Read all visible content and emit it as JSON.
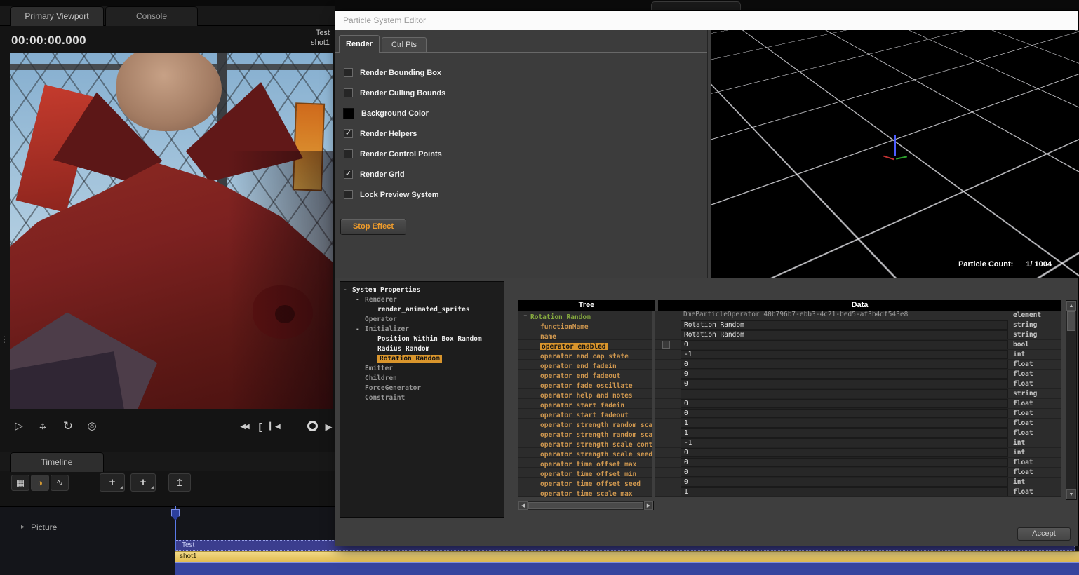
{
  "topbar": {
    "tabs": [
      "Primary Viewport",
      "Console"
    ],
    "timecode": "00:00:00.000",
    "clip_lines": [
      "Test",
      "shot1"
    ]
  },
  "icons": {
    "select": "▷",
    "move_h": "↔",
    "move_v": "↕",
    "rotate": "↻",
    "orbit": "◎",
    "rewind": "◀◀",
    "clip_bracket": "[",
    "to_start": "▎◀",
    "play": "▶",
    "grid_mode": "▦",
    "motion_mode": "◑",
    "graph_mode": "∿",
    "add": "+",
    "up_level": "↥",
    "picture_expander": "▸",
    "check": "✓",
    "scroll_up": "▲",
    "scroll_down": "▼",
    "scroll_left": "◀",
    "scroll_right": "▶",
    "handle_dots": "⋮"
  },
  "timeline": {
    "tab": "Timeline",
    "track_label": "Picture",
    "clips": {
      "parent": "Test",
      "child": "shot1"
    }
  },
  "colors": {
    "highlight_orange": "#d9952c",
    "element_green": "#85a93e",
    "attr_orange": "#d0984f",
    "stop_orange": "#ef9c2c",
    "clip_yellow": "#e9ca6d",
    "clip_blue": "#36449e",
    "clip_purple": "#3b3d8e",
    "background_color_swatch": "#000000"
  },
  "particle_editor": {
    "title": "Particle System Editor",
    "tabs": [
      {
        "label": "Render",
        "active": true
      },
      {
        "label": "Ctrl Pts",
        "active": false
      }
    ],
    "options": [
      {
        "label": "Render Bounding Box",
        "checked": false
      },
      {
        "label": "Render Culling Bounds",
        "checked": false
      },
      {
        "label": "Background Color",
        "swatch": "#000000"
      },
      {
        "label": "Render Helpers",
        "checked": true
      },
      {
        "label": "Render Control Points",
        "checked": false
      },
      {
        "label": "Render Grid",
        "checked": true
      },
      {
        "label": "Lock Preview System",
        "checked": false
      }
    ],
    "stop_button": "Stop Effect",
    "preview": {
      "particle_count_label": "Particle Count:",
      "particle_count_value": "1/ 1004"
    },
    "system_tree": [
      {
        "label": "System Properties",
        "depth": 0,
        "style": "bold",
        "expander": "-"
      },
      {
        "label": "Renderer",
        "depth": 1,
        "style": "dim",
        "expander": "-"
      },
      {
        "label": "render_animated_sprites",
        "depth": 2,
        "style": "bold"
      },
      {
        "label": "Operator",
        "depth": 1,
        "style": "dim"
      },
      {
        "label": "Initializer",
        "depth": 1,
        "style": "dim",
        "expander": "-"
      },
      {
        "label": "Position Within Box Random",
        "depth": 2,
        "style": "bold"
      },
      {
        "label": "Radius Random",
        "depth": 2,
        "style": "bold"
      },
      {
        "label": "Rotation Random",
        "depth": 2,
        "style": "selected"
      },
      {
        "label": "Emitter",
        "depth": 1,
        "style": "dim"
      },
      {
        "label": "Children",
        "depth": 1,
        "style": "dim"
      },
      {
        "label": "ForceGenerator",
        "depth": 1,
        "style": "dim"
      },
      {
        "label": "Constraint",
        "depth": 1,
        "style": "dim"
      }
    ],
    "attribute_table": {
      "columns": [
        "Tree",
        "Data"
      ],
      "rows": [
        {
          "name": "Rotation Random",
          "value": "DmeParticleOperator 40b796b7-ebb3-4c21-bed5-af3b4df543e8",
          "type": "element",
          "name_style": "element",
          "expander": "-",
          "value_style": "plain"
        },
        {
          "name": "functionName",
          "value": "Rotation Random",
          "type": "string"
        },
        {
          "name": "name",
          "value": "Rotation Random",
          "type": "string"
        },
        {
          "name": "operator enabled",
          "value": "0",
          "type": "bool",
          "selected": true,
          "checkbox": true
        },
        {
          "name": "operator end cap state",
          "value": "-1",
          "type": "int"
        },
        {
          "name": "operator end fadein",
          "value": "0",
          "type": "float"
        },
        {
          "name": "operator end fadeout",
          "value": "0",
          "type": "float"
        },
        {
          "name": "operator fade oscillate",
          "value": "0",
          "type": "float"
        },
        {
          "name": "operator help and notes",
          "value": "",
          "type": "string"
        },
        {
          "name": "operator start fadein",
          "value": "0",
          "type": "float"
        },
        {
          "name": "operator start fadeout",
          "value": "0",
          "type": "float"
        },
        {
          "name": "operator strength random scal",
          "value": "1",
          "type": "float"
        },
        {
          "name": "operator strength random scal",
          "value": "1",
          "type": "float"
        },
        {
          "name": "operator strength scale contro",
          "value": "-1",
          "type": "int"
        },
        {
          "name": "operator strength scale seed",
          "value": "0",
          "type": "int"
        },
        {
          "name": "operator time offset max",
          "value": "0",
          "type": "float"
        },
        {
          "name": "operator time offset min",
          "value": "0",
          "type": "float"
        },
        {
          "name": "operator time offset seed",
          "value": "0",
          "type": "int"
        },
        {
          "name": "operator time scale max",
          "value": "1",
          "type": "float"
        }
      ]
    },
    "accept_button": "Accept"
  }
}
